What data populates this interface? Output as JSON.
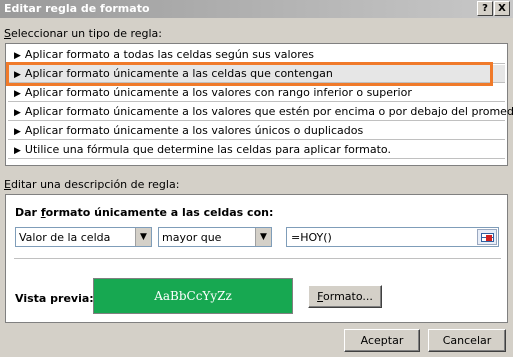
{
  "window": {
    "title": "Editar regla de formato",
    "help_label": "?",
    "close_label": "X"
  },
  "rule_type": {
    "label_prefix": "S",
    "label_rest": "eleccionar un tipo de regla:",
    "items": [
      {
        "label": "Aplicar formato a todas las celdas según sus valores"
      },
      {
        "label": "Aplicar formato únicamente a las celdas que contengan",
        "selected": true
      },
      {
        "label": "Aplicar formato únicamente a los valores con rango inferior o superior"
      },
      {
        "label": "Aplicar formato únicamente a los valores que estén por encima o por debajo del promedio"
      },
      {
        "label": "Aplicar formato únicamente a los valores únicos o duplicados"
      },
      {
        "label": "Utilice una fórmula que determine las celdas para aplicar formato."
      }
    ],
    "arrow_icon": "▶"
  },
  "rule_description": {
    "label_prefix": "E",
    "label_rest": "ditar una descripción de regla:",
    "heading_pre": "Dar ",
    "heading_ul": "f",
    "heading_post": "ormato únicamente a las celdas con:",
    "condition_field": "Valor de la celda",
    "operator": "mayor que",
    "formula": "=HOY()",
    "dropdown_icon": "▼",
    "preview_label": "Vista previa:",
    "preview_text": "AaBbCcYyZz",
    "preview_color": "#17a851",
    "format_button_ul": "F",
    "format_button_rest": "ormato..."
  },
  "buttons": {
    "ok": "Aceptar",
    "cancel": "Cancelar"
  },
  "accent": {
    "highlight": "#f07a2a"
  }
}
